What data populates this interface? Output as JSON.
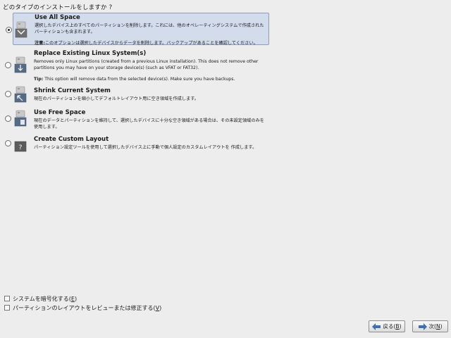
{
  "question": "どのタイプのインストールをしますか ?",
  "options": [
    {
      "title": "Use All Space",
      "desc": "選択したデバイス上のすべてのパーティションを削除します。これには、他のオペレーティングシステムで作成されたパーティションも含まれます。",
      "note_label": "注意:",
      "note": "このオプションは選択したデバイスからデータを削除します。バックアップがあることを確認してください。",
      "icon": "drive-erase-all-icon",
      "selected": true
    },
    {
      "title": "Replace Existing Linux System(s)",
      "desc": "Removes only Linux partitions (created from a previous Linux installation). This does not remove other partitions you may have on your storage device(s) (such as VFAT or FAT32).",
      "note_label": "Tip:",
      "note": "This option will remove data from the selected device(s). Make sure you have backups.",
      "icon": "drive-replace-linux-icon",
      "selected": false
    },
    {
      "title": "Shrink Current System",
      "desc": "現在のパーティションを縮小してデフォルトレイアウト用に空き領域を作成します。",
      "icon": "drive-shrink-icon",
      "selected": false
    },
    {
      "title": "Use Free Space",
      "desc": "現在のデータとパーティションを維持して、選択したデバイスに十分な空き領域がある場合は、その未設定領域のみを使用します。",
      "icon": "drive-free-space-icon",
      "selected": false
    },
    {
      "title": "Create Custom Layout",
      "desc": "パーティション設定ツールを使用して選択したデバイス上に手動で個人設定のカスタムレイアウトを 作成します。",
      "icon": "drive-custom-layout-icon",
      "selected": false
    }
  ],
  "checkboxes": [
    {
      "label": "システムを暗号化する",
      "mnemonic": "E",
      "checked": false
    },
    {
      "label": "パーティションのレイアウトをレビューまたは修正する",
      "mnemonic": "V",
      "checked": false
    }
  ],
  "buttons": {
    "back": {
      "label": "戻る",
      "mnemonic": "B",
      "icon": "arrow-left-icon"
    },
    "next": {
      "label": "次",
      "mnemonic": "N",
      "icon": "arrow-right-icon"
    }
  },
  "colors": {
    "selected_bg": "#d3dceb",
    "arrow": "#3b6fb6"
  }
}
